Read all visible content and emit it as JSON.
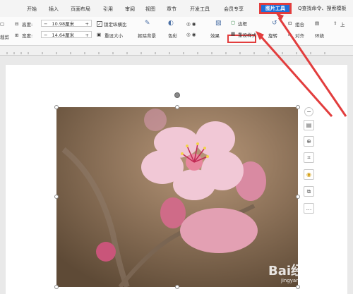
{
  "tabs": [
    "开始",
    "插入",
    "页面布局",
    "引用",
    "审阅",
    "视图",
    "章节",
    "开发工具",
    "会员专享"
  ],
  "active_tab": "图片工具",
  "search_text": "Q查找命令、搜索模板",
  "ribbon": {
    "left_partial_1": "缩",
    "left_partial_2": "裁剪",
    "height_label": "高度:",
    "height_value": "10.98厘米",
    "width_label": "宽度:",
    "width_value": "14.64厘米",
    "lock_ratio": "锁定纵横比",
    "reset_size": "重设大小",
    "remove_bg": "抠除背景",
    "color": "色彩",
    "effects": "效果",
    "border": "边框",
    "reset_style": "重设样式",
    "rotate": "旋转",
    "group": "组合",
    "align": "对齐",
    "surround": "环绕",
    "up": "上"
  },
  "watermark": "Bai经验",
  "watermark_sub": "jingyan.baidu.com",
  "colors": {
    "accent": "#1e6fd9",
    "highlight": "#e23d3d"
  }
}
